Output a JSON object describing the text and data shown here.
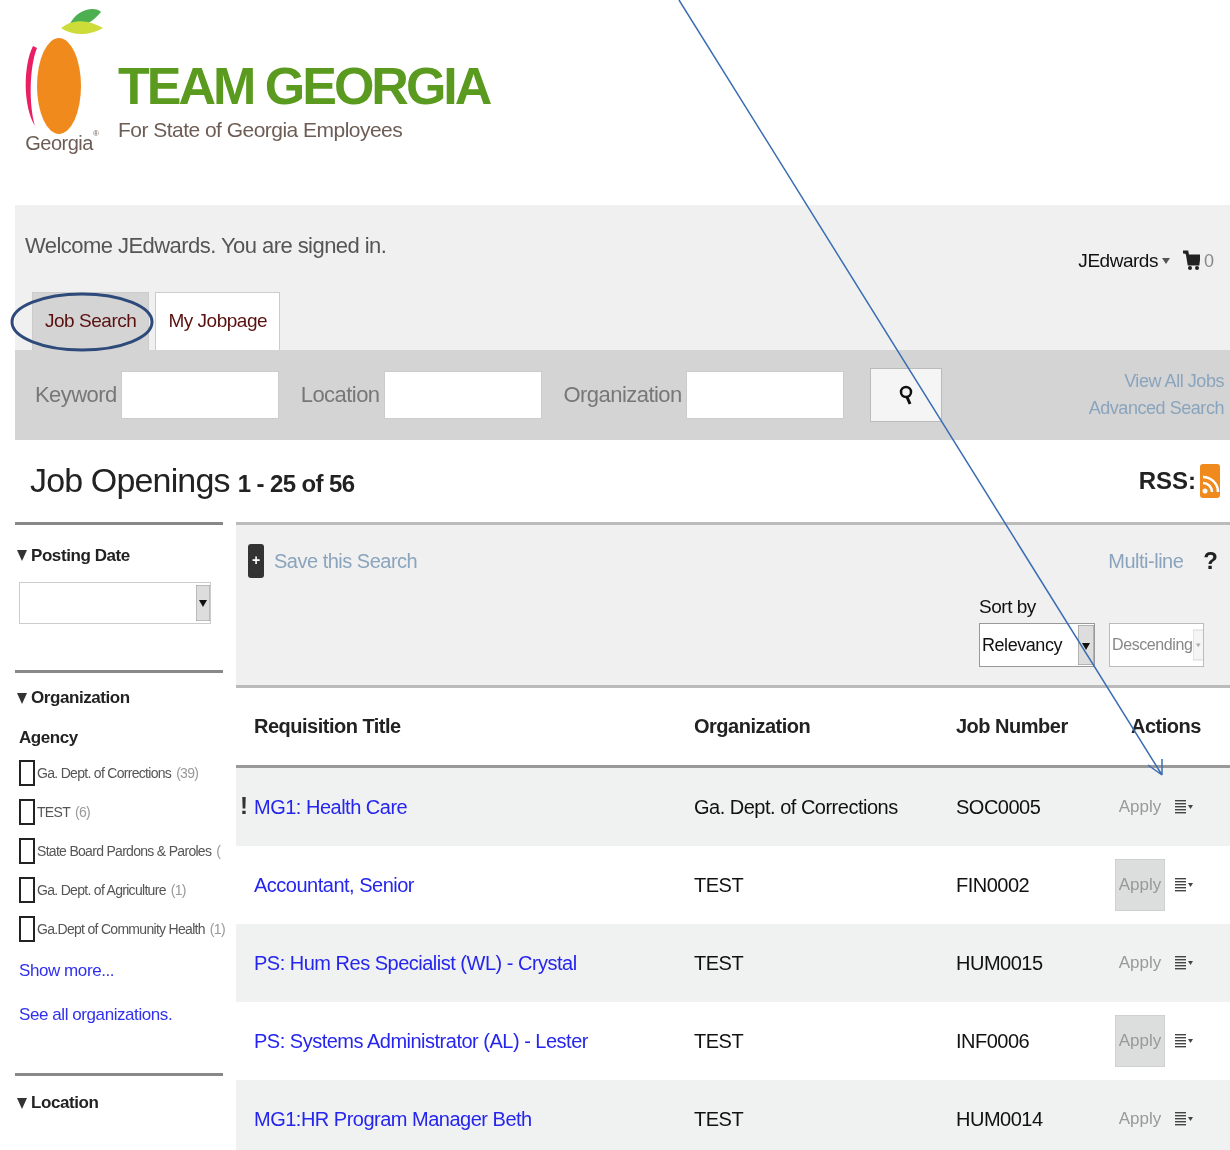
{
  "logo": {
    "brand": "Georgia",
    "registered": "®",
    "title": "TEAM GEORGIA",
    "subtitle": "For State of Georgia Employees"
  },
  "header": {
    "welcome": "Welcome JEdwards. You are signed in.",
    "user": "JEdwards",
    "cart_count": "0"
  },
  "tabs": [
    {
      "label": "Job Search",
      "selected": true
    },
    {
      "label": "My Jobpage",
      "selected": false
    }
  ],
  "search": {
    "fields": [
      {
        "label": "Keyword"
      },
      {
        "label": "Location"
      },
      {
        "label": "Organization"
      }
    ],
    "links": [
      "View All Jobs",
      "Advanced Search"
    ]
  },
  "results": {
    "title": "Job Openings",
    "range": "1 - 25 of 56",
    "rss": "RSS:"
  },
  "filters": {
    "posting_date": {
      "title": "Posting Date",
      "expanded": true
    },
    "organization": {
      "title": "Organization",
      "expanded": true,
      "group": "Agency",
      "items": [
        {
          "label": "Ga. Dept. of Corrections",
          "count": "(39)",
          "checked": false
        },
        {
          "label": "TEST",
          "count": "(6)",
          "checked": false
        },
        {
          "label": "State Board Pardons & Paroles",
          "count": "(",
          "checked": false
        },
        {
          "label": "Ga. Dept. of Agriculture",
          "count": "(1)",
          "checked": false
        },
        {
          "label": "Ga.Dept of Community Health",
          "count": "(1)",
          "checked": false
        }
      ],
      "links": [
        "Show more...",
        "See all organizations."
      ]
    },
    "location": {
      "title": "Location",
      "expanded": true
    }
  },
  "toolbar": {
    "save": "Save this Search",
    "plus": "+",
    "multiline": "Multi-line",
    "help": "?",
    "sort_label": "Sort by",
    "sort_value": "Relevancy",
    "order_value": "Descending"
  },
  "table": {
    "columns": [
      "Requisition Title",
      "Organization",
      "Job Number",
      "Actions"
    ],
    "rows": [
      {
        "flag": "!",
        "title": "MG1: Health Care",
        "organization": "Ga. Dept. of Corrections",
        "job_number": "SOC0005",
        "action": "Apply",
        "action_shaded": false
      },
      {
        "title": "Accountant, Senior",
        "organization": "TEST",
        "job_number": "FIN0002",
        "action": "Apply",
        "action_shaded": true
      },
      {
        "title": "PS: Hum Res Specialist (WL) - Crystal",
        "organization": "TEST",
        "job_number": "HUM0015",
        "action": "Apply",
        "action_shaded": false
      },
      {
        "title": "PS: Systems Administrator (AL) - Lester",
        "organization": "TEST",
        "job_number": "INF0006",
        "action": "Apply",
        "action_shaded": true
      },
      {
        "title": "MG1:HR Program Manager Beth",
        "organization": "TEST",
        "job_number": "HUM0014",
        "action": "Apply",
        "action_shaded": false
      }
    ]
  }
}
